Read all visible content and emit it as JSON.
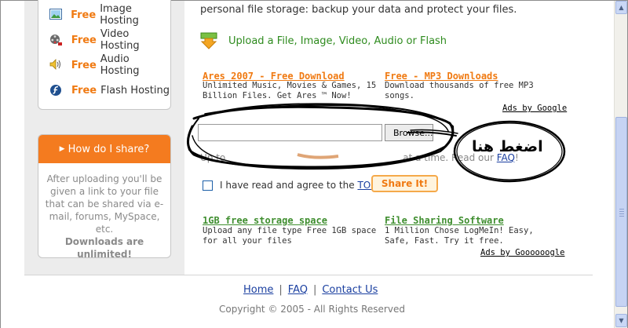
{
  "hosting_menu": {
    "items": [
      {
        "free": "Free",
        "label": "Image Hosting",
        "icon": "image-icon"
      },
      {
        "free": "Free",
        "label": "Video Hosting",
        "icon": "film-reel-icon"
      },
      {
        "free": "Free",
        "label": "Audio Hosting",
        "icon": "speaker-icon"
      },
      {
        "free": "Free",
        "label": "Flash Hosting",
        "icon": "flash-icon"
      }
    ]
  },
  "share_panel": {
    "heading": "How do I share?",
    "body": "After uploading you'll be given a link to your file that can be shared via e-mail, forums, MySpace, etc.",
    "strong": "Downloads are unlimited!"
  },
  "main": {
    "intro": "personal file storage: backup your data and protect your files.",
    "upload_label": "Upload a File, Image, Video, Audio or Flash"
  },
  "ads_top": {
    "left_title": "Ares 2007 - Free Download",
    "left_text": "Unlimited Music, Movies & Games, 15 Billion Files. Get Ares ™ Now!",
    "right_title": "Free - MP3 Downloads",
    "right_text": "Download thousands of free MP3 songs.",
    "ads_by": "Ads by Google"
  },
  "upload_form": {
    "browse_label": "Browse...",
    "limit_prefix": "Up to",
    "limit_suffix": "at a time. Read our",
    "faq_link": "FAQ",
    "faq_close": "!",
    "tos_prefix": "I have read and agree to the",
    "tos_link": "TOS",
    "share_button": "Share It!"
  },
  "annotation": {
    "arabic_text": "اضغط هنا"
  },
  "ads_bottom": {
    "left_title": "1GB free storage space",
    "left_text": "Upload any file type Free 1GB space for all your files",
    "right_title": "File Sharing Software",
    "right_text": "1 Million Chose LogMeIn! Easy, Safe, Fast. Try it free.",
    "ads_by": "Ads by Goooooogle"
  },
  "footer": {
    "home": "Home",
    "faq": "FAQ",
    "contact": "Contact Us",
    "copyright": "Copyright © 2005 - All Rights Reserved"
  },
  "colors": {
    "accent_orange": "#f07a12",
    "link_blue": "#1a3fa0",
    "upload_green": "#2e8b1e"
  }
}
